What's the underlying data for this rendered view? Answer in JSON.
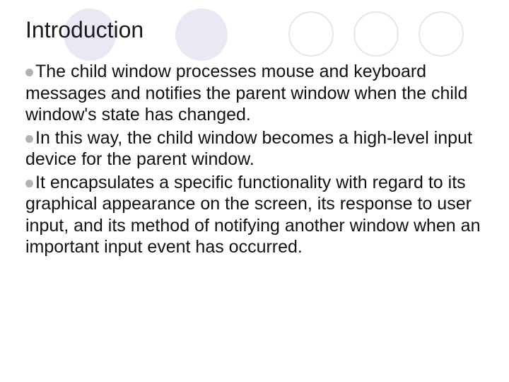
{
  "colors": {
    "bullet": "#b3b3b3",
    "deco_light": "#ece7f4",
    "deco_ring": "#e9e4f2"
  },
  "title": "Introduction",
  "bullets": [
    "The child window processes mouse and keyboard messages and notifies the parent window when the child window's state has changed.",
    "In this way, the child window becomes a high-level input device for the parent window.",
    "It encapsulates a specific functionality with regard to its graphical appearance on the screen, its response to user input, and its method of notifying another window when an important input event has occurred."
  ]
}
